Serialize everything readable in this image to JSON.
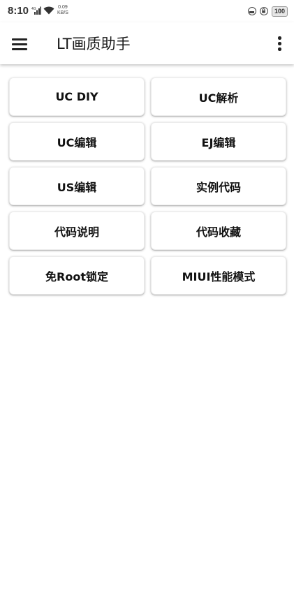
{
  "status_bar": {
    "time": "8:10",
    "network_type": "4G",
    "speed_value": "0.09",
    "speed_unit": "KB/S",
    "battery": "100",
    "icons": [
      "signal-icon",
      "wifi-icon",
      "data-saver-icon",
      "lock-icon",
      "battery-icon"
    ]
  },
  "app_bar": {
    "title": "LT画质助手",
    "menu_icon": "hamburger-menu-icon",
    "overflow_icon": "more-vert-icon"
  },
  "buttons": [
    {
      "label": "UC DIY"
    },
    {
      "label": "UC解析"
    },
    {
      "label": "UC编辑"
    },
    {
      "label": "EJ编辑"
    },
    {
      "label": "US编辑"
    },
    {
      "label": "实例代码"
    },
    {
      "label": "代码说明"
    },
    {
      "label": "代码收藏"
    },
    {
      "label": "免Root锁定"
    },
    {
      "label": "MIUI性能模式"
    }
  ],
  "colors": {
    "background": "#ffffff",
    "text": "#111111",
    "card": "#ffffff"
  }
}
